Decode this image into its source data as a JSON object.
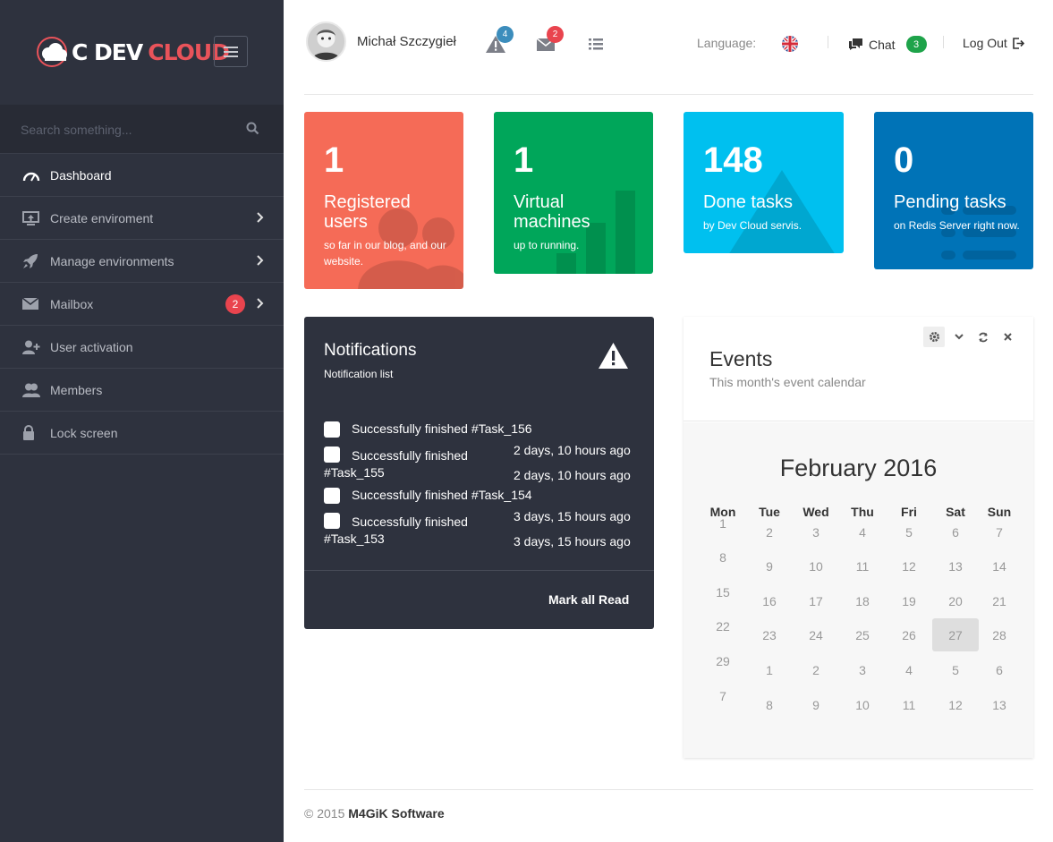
{
  "brand": {
    "logo_part1": "C DEV",
    "logo_part2": "CLOUD"
  },
  "search": {
    "placeholder": "Search something..."
  },
  "sidebar": {
    "items": [
      {
        "label": "Dashboard",
        "icon": "dashboard-icon"
      },
      {
        "label": "Create enviroment",
        "icon": "upload-screen-icon"
      },
      {
        "label": "Manage environments",
        "icon": "rocket-icon"
      },
      {
        "label": "Mailbox",
        "icon": "envelope-icon",
        "badge": "2"
      },
      {
        "label": "User activation",
        "icon": "user-plus-icon"
      },
      {
        "label": "Members",
        "icon": "users-icon"
      },
      {
        "label": "Lock screen",
        "icon": "lock-icon"
      }
    ]
  },
  "topbar": {
    "username": "Michał Szczygieł",
    "alerts_count": "4",
    "messages_count": "2",
    "language_label": "Language:",
    "chat_label": "Chat",
    "chat_count": "3",
    "logout_label": "Log Out"
  },
  "stats": [
    {
      "number": "1",
      "label": "Registered users",
      "sub": "so far in our blog, and our website.",
      "color": "#f56b57"
    },
    {
      "number": "1",
      "label": "Virtual machines",
      "sub": "up to running.",
      "color": "#00a65a"
    },
    {
      "number": "148",
      "label": "Done tasks",
      "sub": "by Dev Cloud servis.",
      "color": "#00c0ef"
    },
    {
      "number": "0",
      "label": "Pending tasks",
      "sub": "on Redis Server right now.",
      "color": "#0073b7"
    }
  ],
  "notifications": {
    "title": "Notifications",
    "subtitle": "Notification list",
    "items": [
      {
        "text": "Successfully finished #Task_156",
        "date": "2 days, 10 hours ago"
      },
      {
        "text": "Successfully finished #Task_155",
        "date": "2 days, 10 hours ago"
      },
      {
        "text": "Successfully finished #Task_154",
        "date": "3 days, 15 hours ago"
      },
      {
        "text": "Successfully finished #Task_153",
        "date": "3 days, 15 hours ago"
      }
    ],
    "mark_all": "Mark all Read"
  },
  "events": {
    "title": "Events",
    "subtitle": "This month's event calendar",
    "calendar_title": "February 2016",
    "weekdays": [
      "Mon",
      "Tue",
      "Wed",
      "Thu",
      "Fri",
      "Sat",
      "Sun"
    ],
    "weeks": [
      [
        "1",
        "2",
        "3",
        "4",
        "5",
        "6",
        "7"
      ],
      [
        "8",
        "9",
        "10",
        "11",
        "12",
        "13",
        "14"
      ],
      [
        "15",
        "16",
        "17",
        "18",
        "19",
        "20",
        "21"
      ],
      [
        "22",
        "23",
        "24",
        "25",
        "26",
        "27",
        "28"
      ],
      [
        "29",
        "1",
        "2",
        "3",
        "4",
        "5",
        "6"
      ],
      [
        "7",
        "8",
        "9",
        "10",
        "11",
        "12",
        "13"
      ]
    ],
    "today": "27"
  },
  "footer": {
    "copyright": "© 2015",
    "company": "M4GiK Software"
  },
  "colors": {
    "sidebar": "#2e323e",
    "accent_red": "#e9444e",
    "green": "#1ea34a",
    "alert_blue": "#3c8dbc"
  }
}
